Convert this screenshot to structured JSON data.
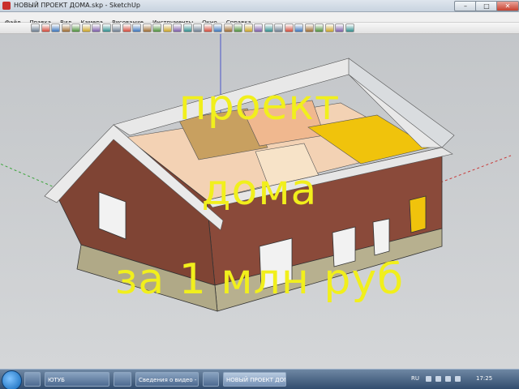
{
  "window": {
    "title": "НОВЫЙ ПРОЕКТ ДОМА.skp - SketchUp",
    "minimize_label": "–",
    "maximize_label": "□",
    "close_label": "✕"
  },
  "menu": [
    "Файл",
    "Правка",
    "Вид",
    "Камера",
    "Рисование",
    "Инструменты",
    "Окно",
    "Справка"
  ],
  "toolbar": {
    "icons": [
      "select-icon",
      "eraser-icon",
      "pencil-icon",
      "rectangle-icon",
      "circle-icon",
      "arc-icon",
      "polygon-icon",
      "make-component-icon",
      "paint-bucket-icon",
      "push-pull-icon",
      "move-icon",
      "rotate-icon",
      "offset-icon",
      "follow-me-icon",
      "scale-icon",
      "orbit-icon",
      "pan-icon",
      "zoom-icon",
      "zoom-window-icon",
      "zoom-extents-icon",
      "previous-view-icon",
      "next-view-icon",
      "tape-measure-icon",
      "dimension-icon",
      "protractor-icon",
      "text-icon",
      "axes-icon",
      "3d-text-icon",
      "warehouse-icon",
      "share-model-icon",
      "components-icon",
      "extension-icon"
    ]
  },
  "overlay": {
    "line1": "проект",
    "line2": "дома",
    "line3": "за  1  млн  руб"
  },
  "taskbar": {
    "items": [
      {
        "label": "ЮТУБ"
      },
      {
        "label": ""
      },
      {
        "label": "Сведения о видео - ..."
      },
      {
        "label": ""
      },
      {
        "label": "НОВЫЙ ПРОЕКТ ДОМ..."
      }
    ],
    "language": "RU",
    "time": "17:25"
  },
  "colors": {
    "overlay_text": "#f1ef1c",
    "brick": "#8a4a3a",
    "stone": "#b7b08f",
    "roof_trim": "#eaeaea",
    "accent_yellow": "#f0c30c"
  }
}
